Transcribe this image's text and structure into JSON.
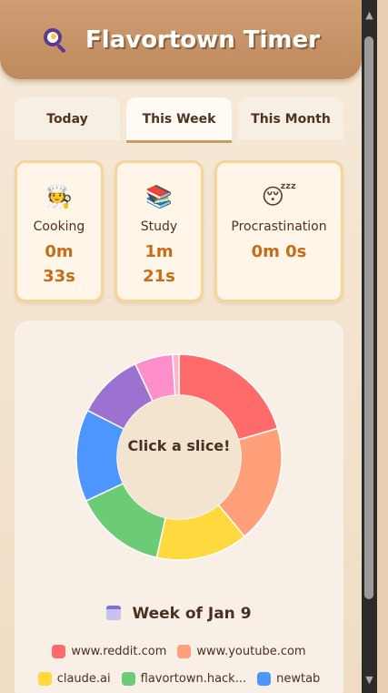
{
  "header": {
    "title": "Flavortown Timer",
    "logo_icon": "frying-pan-icon"
  },
  "tabs": [
    {
      "label": "Today",
      "active": false
    },
    {
      "label": "This Week",
      "active": true
    },
    {
      "label": "This Month",
      "active": false
    }
  ],
  "cards": [
    {
      "emoji": "🧑‍🍳",
      "icon": "chef-icon",
      "label": "Cooking",
      "value_line1": "0m",
      "value_line2": "33s"
    },
    {
      "emoji": "📚",
      "icon": "books-icon",
      "label": "Study",
      "value_line1": "1m",
      "value_line2": "21s"
    },
    {
      "emoji": "😴",
      "icon": "sleeping-face-icon",
      "label": "Procrastination",
      "value_line1": "0m 0s",
      "value_line2": ""
    }
  ],
  "chart_data": {
    "type": "pie",
    "center_text": "Click a slice!",
    "slices": [
      {
        "label": "www.reddit.com",
        "value": 20.5,
        "color": "#ff6b6b"
      },
      {
        "label": "www.youtube.com",
        "value": 18.5,
        "color": "#ffa07a"
      },
      {
        "label": "claude.ai",
        "value": 14.5,
        "color": "#ffd93d"
      },
      {
        "label": "flavortown.hack...",
        "value": 14.5,
        "color": "#6bcb77"
      },
      {
        "label": "newtab",
        "value": 14.5,
        "color": "#4d96ff"
      },
      {
        "label": "",
        "value": 10.5,
        "color": "#9b72cf"
      },
      {
        "label": "",
        "value": 6,
        "color": "#ff8fcb"
      },
      {
        "label": "",
        "value": 1,
        "color": "#ffb3c6"
      }
    ]
  },
  "week_label": "Week of Jan 9",
  "week_icon": "calendar-icon",
  "legend": [
    {
      "label": "www.reddit.com",
      "color": "#ff6b6b"
    },
    {
      "label": "www.youtube.com",
      "color": "#ffa07a"
    },
    {
      "label": "claude.ai",
      "color": "#ffd93d"
    },
    {
      "label": "flavortown.hack...",
      "color": "#6bcb77"
    },
    {
      "label": "newtab",
      "color": "#4d96ff"
    }
  ]
}
